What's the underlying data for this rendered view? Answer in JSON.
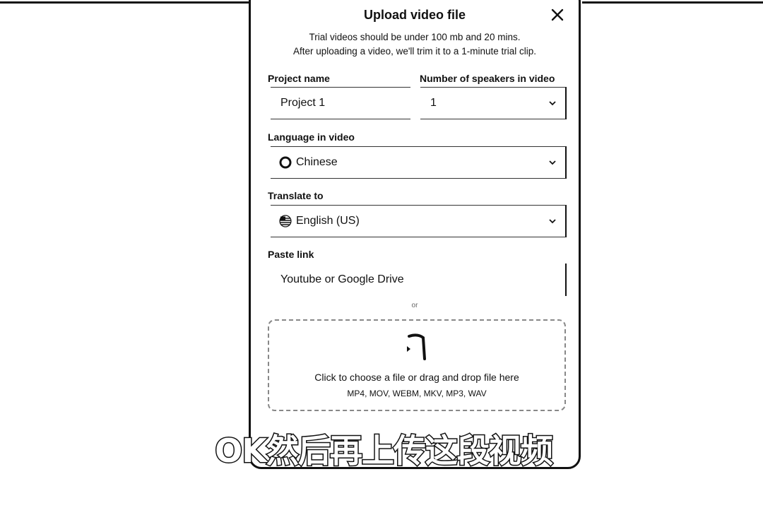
{
  "modal": {
    "title": "Upload video file",
    "notice_line1": "Trial videos should be under 100 mb and 20 mins.",
    "notice_line2": "After uploading a video, we'll trim it to a 1-minute trial clip."
  },
  "form": {
    "project_name": {
      "label": "Project name",
      "value": "Project 1"
    },
    "speakers": {
      "label": "Number of speakers in video",
      "value": "1"
    },
    "language": {
      "label": "Language in video",
      "value": "Chinese",
      "icon": "globe-icon"
    },
    "translate": {
      "label": "Translate to",
      "value": "English (US)",
      "icon": "us-flag-icon"
    },
    "paste_link": {
      "label": "Paste link",
      "placeholder": "Youtube or Google Drive"
    },
    "or_text": "or"
  },
  "dropzone": {
    "text": "Click to choose a file or drag and drop file here",
    "formats": "MP4, MOV, WEBM, MKV, MP3, WAV"
  },
  "subtitle": "OK然后再上传这段视频"
}
